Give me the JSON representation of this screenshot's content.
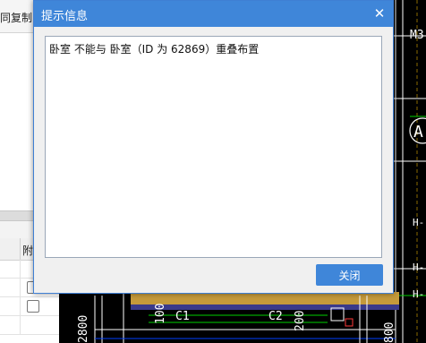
{
  "left_panel": {
    "toolbar_label": "同复制",
    "grid_header": "附"
  },
  "cad": {
    "labels": {
      "m3": "M3",
      "a": "A",
      "h_1": "H-",
      "h_2": "H-",
      "h_3": "H-",
      "c1": "C1",
      "c2": "C2",
      "dim_2800": "2800",
      "dim_100": "100",
      "dim_200": "200",
      "dim_800": "800"
    }
  },
  "dialog": {
    "title": "提示信息",
    "close_icon": "close-icon",
    "message": "卧室 不能与 卧室（ID 为 62869）重叠布置",
    "button_label": "关闭"
  },
  "colors": {
    "titlebar": "#3f86d9",
    "cad_background": "#000000"
  }
}
